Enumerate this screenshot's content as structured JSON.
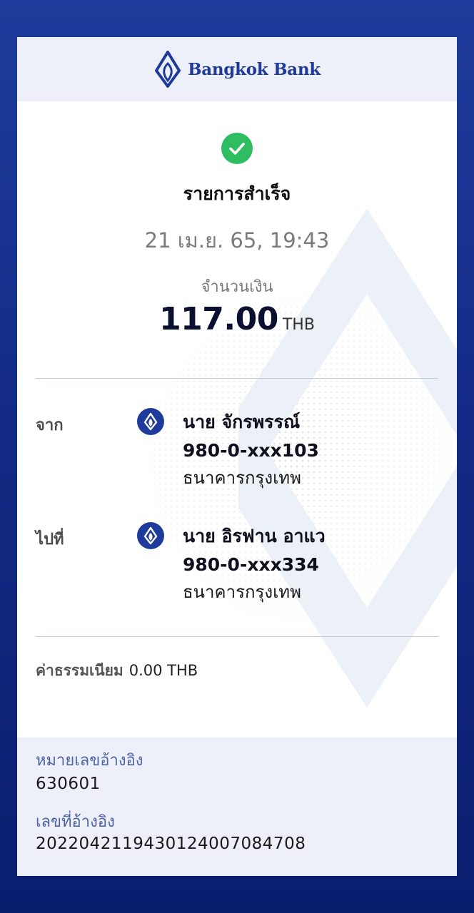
{
  "header": {
    "brand_name": "Bangkok Bank",
    "logo_icon": "bangkok-bank-lotus-icon",
    "brand_color": "#1e3a9a"
  },
  "status": {
    "icon": "check-circle-icon",
    "icon_color": "#2fbd62",
    "text": "รายการสำเร็จ",
    "datetime": "21 เม.ย. 65, 19:43"
  },
  "amount": {
    "label": "จำนวนเงิน",
    "value": "117.00",
    "currency": "THB"
  },
  "from": {
    "label": "จาก",
    "bank_icon": "bangkok-bank-icon",
    "name": "นาย จักรพรรณ์",
    "account": "980-0-xxx103",
    "bank": "ธนาคารกรุงเทพ"
  },
  "to": {
    "label": "ไปที่",
    "bank_icon": "bangkok-bank-icon",
    "name": "นาย อิรฟาน อาแว",
    "account": "980-0-xxx334",
    "bank": "ธนาคารกรุงเทพ"
  },
  "fee": {
    "label": "ค่าธรรมเนียม",
    "value": "0.00 THB"
  },
  "reference": {
    "ref_label": "หมายเลขอ้างอิง",
    "ref_value": "630601",
    "txn_label": "เลขที่อ้างอิง",
    "txn_value": "2022042119430124007084708"
  }
}
